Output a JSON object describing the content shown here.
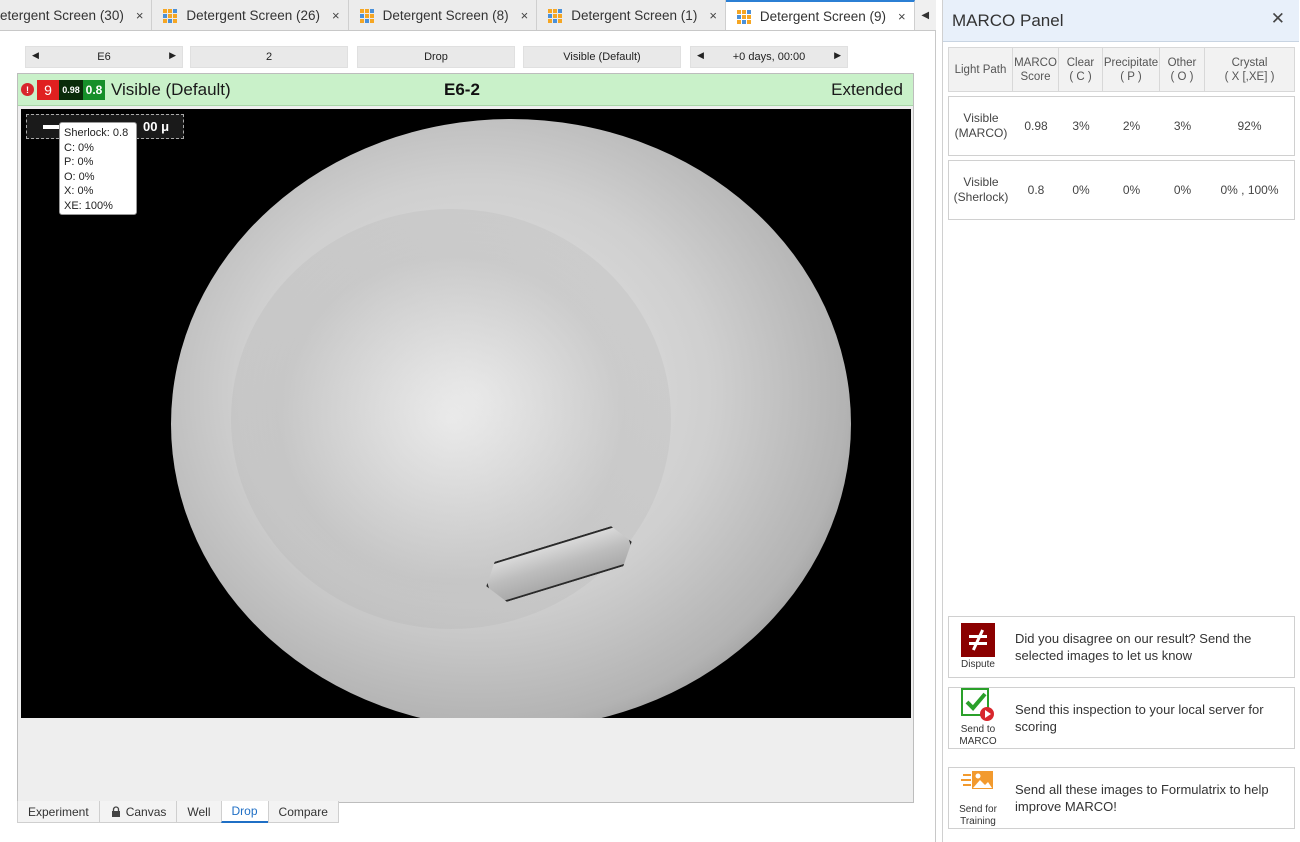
{
  "tabs": [
    {
      "label": "etergent Screen (30)",
      "active": false
    },
    {
      "label": "Detergent Screen (26)",
      "active": false
    },
    {
      "label": "Detergent Screen (8)",
      "active": false
    },
    {
      "label": "Detergent Screen (1)",
      "active": false
    },
    {
      "label": "Detergent Screen (9)",
      "active": true
    }
  ],
  "tab_close_glyph": "×",
  "tab_scroll_glyph": "◀",
  "nav": {
    "well": "E6",
    "drop": "2",
    "image_type": "Drop",
    "light_path": "Visible (Default)",
    "time": "+0 days, 00:00",
    "left_arrow": "◀",
    "right_arrow": "▶"
  },
  "infobar": {
    "error_glyph": "!",
    "score_red": "9",
    "score_marco": "0.98",
    "score_sherlock": "0.8",
    "light_path": "Visible (Default)",
    "well_drop": "E6-2",
    "focus": "Extended",
    "bg_color": "#c9f1c9"
  },
  "image": {
    "scale_label": "00 μ",
    "tooltip": [
      "Sherlock: 0.8",
      "C: 0%",
      "P: 0%",
      "O: 0%",
      "X: 0%",
      "XE: 100%"
    ]
  },
  "bottom_tabs": [
    {
      "label": "Experiment",
      "active": false
    },
    {
      "label": "Canvas",
      "active": false,
      "icon": "lock-icon"
    },
    {
      "label": "Well",
      "active": false
    },
    {
      "label": "Drop",
      "active": true
    },
    {
      "label": "Compare",
      "active": false
    }
  ],
  "panel": {
    "title": "MARCO Panel",
    "close_glyph": "✕",
    "headers": [
      "Light Path",
      "MARCO\nScore",
      "Clear\n( C )",
      "Precipitate\n( P )",
      "Other\n( O )",
      "Crystal\n( X [,XE] )"
    ],
    "rows": [
      [
        "Visible\n(MARCO)",
        "0.98",
        "3%",
        "2%",
        "3%",
        "92%"
      ],
      [
        "Visible\n(Sherlock)",
        "0.8",
        "0%",
        "0%",
        "0%",
        "0% , 100%"
      ]
    ],
    "actions": [
      {
        "icon": "not-equal-icon",
        "label": "Dispute",
        "text": "Did you disagree on our result? Send the selected images to let us know"
      },
      {
        "icon": "send-check-icon",
        "label": "Send to\nMARCO",
        "text": "Send this inspection to your local server for scoring"
      },
      {
        "icon": "send-image-icon",
        "label": "Send for\nTraining",
        "text": "Send all these images to Formulatrix to help improve MARCO!"
      }
    ]
  },
  "colors": {
    "accent": "#2b7fd4",
    "dispute": "#8b0000",
    "send_green": "#2aa02a",
    "training_orange": "#f29a2e"
  }
}
